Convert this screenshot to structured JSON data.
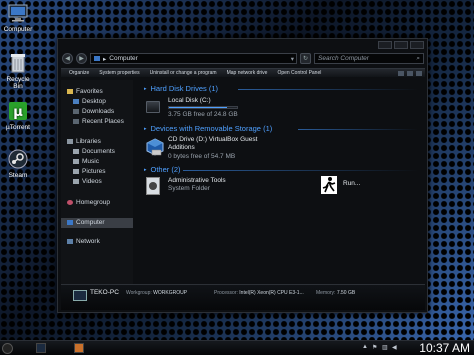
{
  "desktop": {
    "icons": [
      {
        "label": "Computer",
        "icon": "computer-icon"
      },
      {
        "label": "Recycle Bin",
        "icon": "recycle-bin-icon"
      },
      {
        "label": "µTorrent",
        "icon": "utorrent-icon"
      },
      {
        "label": "Steam",
        "icon": "steam-icon"
      }
    ]
  },
  "window": {
    "address": {
      "path": "Computer",
      "separator": "▸"
    },
    "search_placeholder": "Search Computer",
    "toolbar": {
      "organize": "Organize",
      "system_properties": "System properties",
      "uninstall": "Uninstall or change a program",
      "map_drive": "Map network drive",
      "control_panel": "Open Control Panel"
    },
    "nav": {
      "favorites": "Favorites",
      "desktop": "Desktop",
      "downloads": "Downloads",
      "recent": "Recent Places",
      "libraries": "Libraries",
      "documents": "Documents",
      "music": "Music",
      "pictures": "Pictures",
      "videos": "Videos",
      "homegroup": "Homegroup",
      "computer": "Computer",
      "network": "Network"
    },
    "groups": {
      "hdd": "Hard Disk Drives (1)",
      "removable": "Devices with Removable Storage (1)",
      "other": "Other (2)"
    },
    "items": {
      "local_disk": {
        "name": "Local Disk (C:)",
        "free": "3.75 GB free of 24.8 GB",
        "used_fraction": 0.85
      },
      "cd_drive": {
        "name": "CD Drive (D:) VirtualBox Guest Additions",
        "free": "0 bytes free of 54.7 MB"
      },
      "admin_tools": {
        "name": "Administrative Tools",
        "type": "System Folder"
      },
      "run": {
        "name": "Run..."
      }
    },
    "details": {
      "pc_name": "TEKO-PC",
      "workgroup_label": "Workgroup:",
      "workgroup": "WORKGROUP",
      "processor_label": "Processor:",
      "processor": "Intel(R) Xeon(R) CPU E3-1...",
      "memory_label": "Memory:",
      "memory": "7.50 GB"
    }
  },
  "taskbar": {
    "clock": "10:37 AM"
  },
  "colors": {
    "accent": "#4fa0ff",
    "background": "#0d0f12"
  }
}
